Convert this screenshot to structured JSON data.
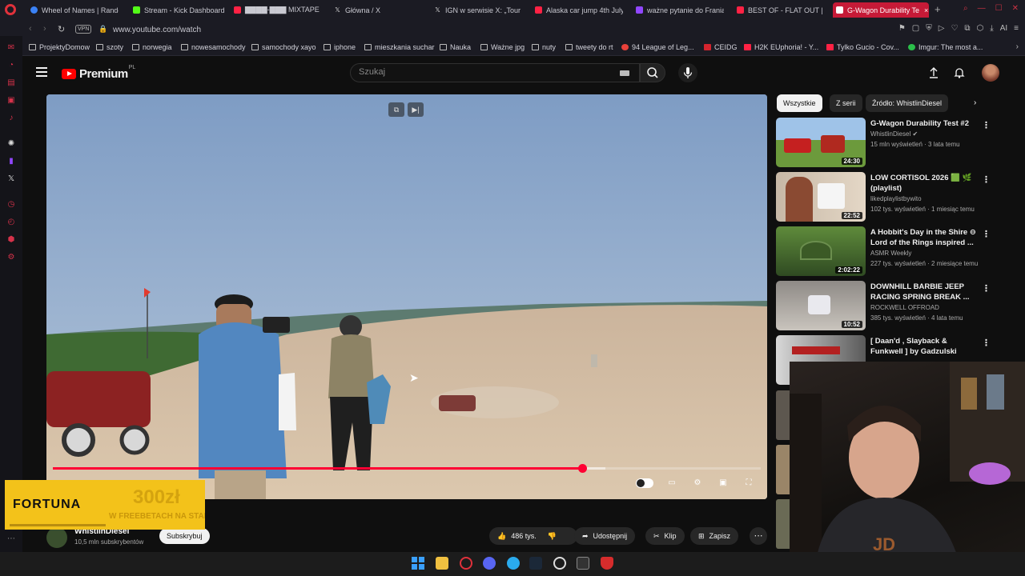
{
  "browser": {
    "tabs": [
      {
        "label": "Wheel of Names | Rando",
        "color": "#3b82f6"
      },
      {
        "label": "Stream - Kick Dashboard",
        "color": "#53fc18"
      },
      {
        "label": "▇▇▇▇-▇▇▇ MIXTAPE",
        "color": "#ff2244"
      },
      {
        "label": "Główna / X",
        "color": "#333333"
      },
      {
        "label": "IGN w serwisie X: „Tour T",
        "color": "#333333"
      },
      {
        "label": "Alaska car jump 4th July",
        "color": "#ff2244"
      },
      {
        "label": "ważne pytanie do Frania",
        "color": "#9147ff"
      },
      {
        "label": "BEST OF - FLAT OUT | W",
        "color": "#ff2244"
      },
      {
        "label": "G-Wagon Durability Te",
        "color": "#ffffff"
      }
    ],
    "active_tab_close": "×",
    "new_tab": "+",
    "url": "www.youtube.com/watch",
    "vpn_label": "VPN",
    "ai_label": "AI",
    "bookmarks": [
      {
        "label": "ProjektyDomow",
        "icon": "folder-icon"
      },
      {
        "label": "szoty",
        "icon": "folder-icon"
      },
      {
        "label": "norwegia",
        "icon": "folder-icon"
      },
      {
        "label": "nowesamochody",
        "icon": "folder-icon"
      },
      {
        "label": "samochody xayo",
        "icon": "folder-icon"
      },
      {
        "label": "iphone",
        "icon": "folder-icon"
      },
      {
        "label": "mieszkania suchar",
        "icon": "folder-icon"
      },
      {
        "label": "Nauka",
        "icon": "folder-icon"
      },
      {
        "label": "Ważne jpg",
        "icon": "folder-icon"
      },
      {
        "label": "nuty",
        "icon": "folder-icon"
      },
      {
        "label": "tweety do rt",
        "icon": "folder-icon"
      },
      {
        "label": "94 League of Leg...",
        "icon": "site-icon"
      },
      {
        "label": "CEIDG",
        "icon": "site-icon"
      },
      {
        "label": "H2K EUphoria! - Y...",
        "icon": "site-icon"
      },
      {
        "label": "Tylko Gucio - Cov...",
        "icon": "site-icon"
      },
      {
        "label": "Imgur: The most a...",
        "icon": "site-icon"
      }
    ]
  },
  "youtube": {
    "logo_text": "Premium",
    "logo_region": "PL",
    "search_placeholder": "Szukaj",
    "progress": {
      "played_fraction": 0.748,
      "buffered_fraction": 0.78
    },
    "channel": {
      "name": "WhistlinDiesel",
      "subscribers": "10,5 mln subskrybentów"
    },
    "subscribe_label": "Subskrybuj",
    "actions": {
      "likes": "486 tys.",
      "share": "Udostępnij",
      "clip": "Klip",
      "save": "Zapisz"
    },
    "chips": [
      "Wszystkie",
      "Z serii",
      "Źródło: WhistlinDiesel"
    ],
    "recommendations": [
      {
        "title": "G-Wagon Durability Test #2",
        "channel": "WhistlinDiesel",
        "meta": "15 mln wyświetleń · 3 lata temu",
        "duration": "24:30",
        "verified": "true"
      },
      {
        "title": "LOW CORTISOL 2026 🟩 🌿 (playlist)",
        "channel": "likedplaylistbywito",
        "meta": "102 tys. wyświetleń · 1 miesiąc temu",
        "duration": "22:52"
      },
      {
        "title": "A Hobbit's Day in the Shire ⊖ Lord of the Rings inspired ...",
        "channel": "ASMR Weekly",
        "meta": "227 tys. wyświetleń · 2 miesiące temu",
        "duration": "2:02:22"
      },
      {
        "title": "DOWNHILL BARBIE JEEP RACING SPRING BREAK ...",
        "channel": "ROCKWELL OFFROAD",
        "meta": "385 tys. wyświetleń · 4 lata temu",
        "duration": "10:52"
      },
      {
        "title": "[ Daan'd , Slayback & Funkwell ] by Gadzulski",
        "channel": "",
        "meta": "",
        "duration": ""
      }
    ]
  },
  "ad": {
    "brand": "FORTUNA",
    "amount": "300zł",
    "slogan": "W FREEBETACH NA START"
  },
  "colors": {
    "accent": "#ff0033",
    "active_tab": "#c61a37",
    "ad_yellow": "#f3c21a"
  }
}
